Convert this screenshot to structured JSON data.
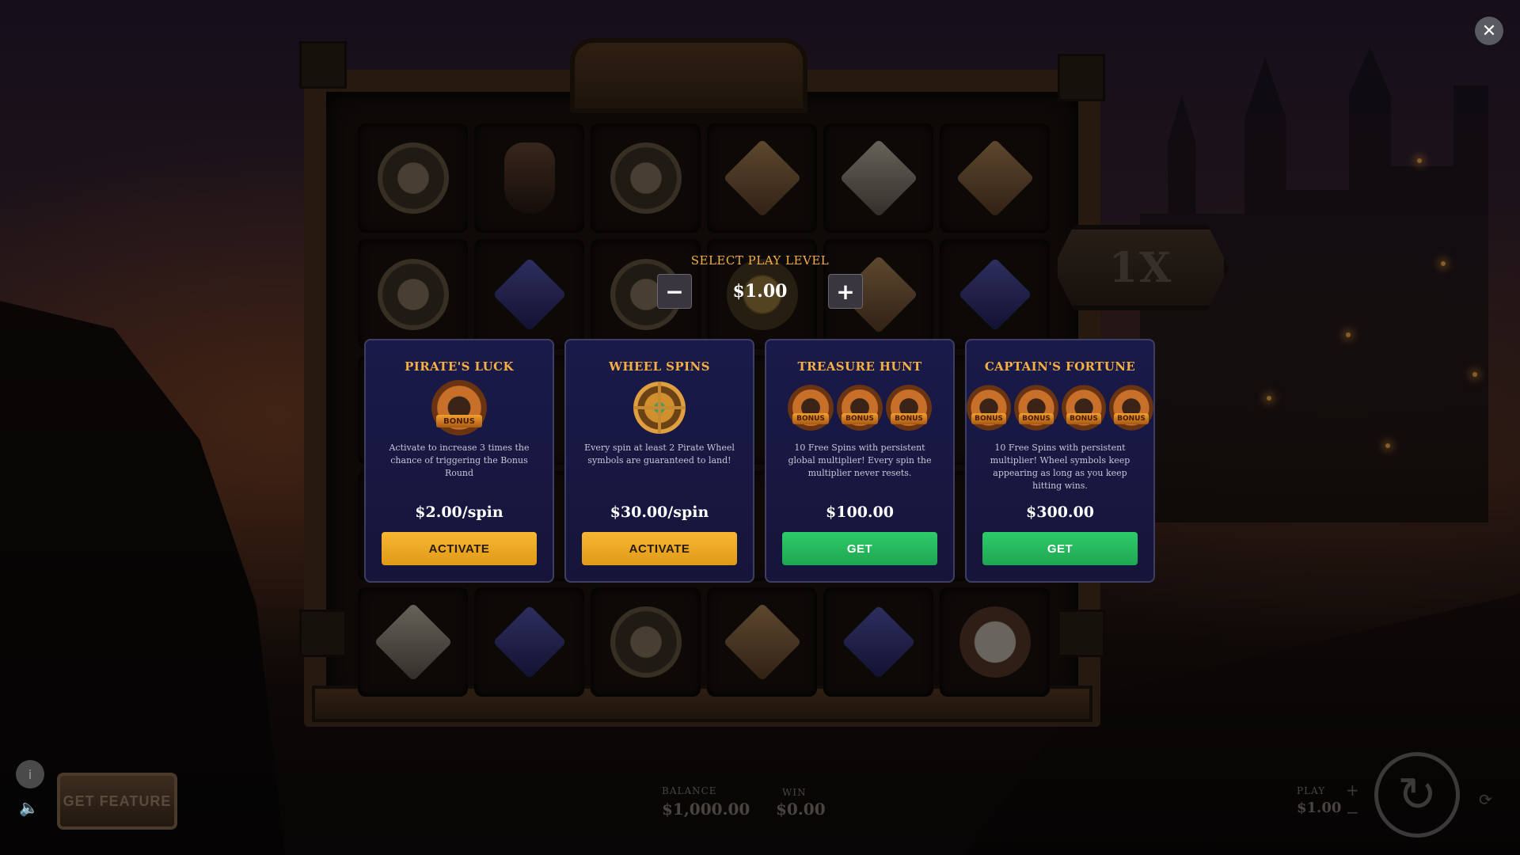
{
  "modal": {
    "close_symbol": "✕",
    "play_level": {
      "title": "SELECT PLAY LEVEL",
      "value": "$1.00",
      "decrement_symbol": "−",
      "increment_symbol": "+"
    },
    "cards": [
      {
        "title": "PIRATE'S LUCK",
        "icon": "bonus-badge",
        "icon_count": 1,
        "icon_text": "BONUS",
        "description": "Activate to increase 3 times the chance of triggering the Bonus Round",
        "price": "$2.00/spin",
        "button": "ACTIVATE"
      },
      {
        "title": "WHEEL SPINS",
        "icon": "ship-wheel",
        "icon_count": 1,
        "description": "Every spin at least 2 Pirate Wheel symbols are guaranteed to land!",
        "price": "$30.00/spin",
        "button": "ACTIVATE"
      },
      {
        "title": "TREASURE HUNT",
        "icon": "bonus-badge",
        "icon_count": 3,
        "icon_text": "BONUS",
        "description": "10 Free Spins with persistent global multiplier! Every spin the multiplier never resets.",
        "price": "$100.00",
        "button": "GET"
      },
      {
        "title": "CAPTAIN'S FORTUNE",
        "icon": "bonus-badge",
        "icon_count": 4,
        "icon_text": "BONUS",
        "description": "10 Free Spins with persistent multiplier! Wheel symbols keep appearing as long as you keep hitting wins.",
        "price": "$300.00",
        "button": "GET"
      }
    ]
  },
  "game": {
    "multiplier": "1X",
    "reel_symbols": [
      [
        "compass",
        "bottle",
        "compass",
        "gem-gold",
        "gem-white",
        "gem-gold"
      ],
      [
        "compass",
        "gem-blue",
        "compass",
        "coins",
        "gem-gold",
        "gem-blue"
      ],
      [
        "",
        "",
        "",
        "",
        "",
        ""
      ],
      [
        "",
        "",
        "",
        "",
        "",
        ""
      ],
      [
        "gem-white",
        "gem-blue",
        "compass",
        "gem-gold",
        "gem-blue",
        "skull"
      ]
    ]
  },
  "hud": {
    "info_symbol": "i",
    "sound_symbol": "🔈",
    "get_feature": "GET FEATURE",
    "balance_label": "BALANCE",
    "balance_value": "$1,000.00",
    "win_label": "WIN",
    "win_value": "$0.00",
    "play_label": "PLAY",
    "play_value": "$1.00",
    "spin_symbol": "↻",
    "plus_symbol": "+",
    "minus_symbol": "−",
    "autoplay_symbol": "⟳"
  },
  "colors": {
    "accent_gold": "#f5b041",
    "activate_button": "#f7b733",
    "get_button": "#2ecc6a",
    "card_background": "#1a1a4a"
  }
}
